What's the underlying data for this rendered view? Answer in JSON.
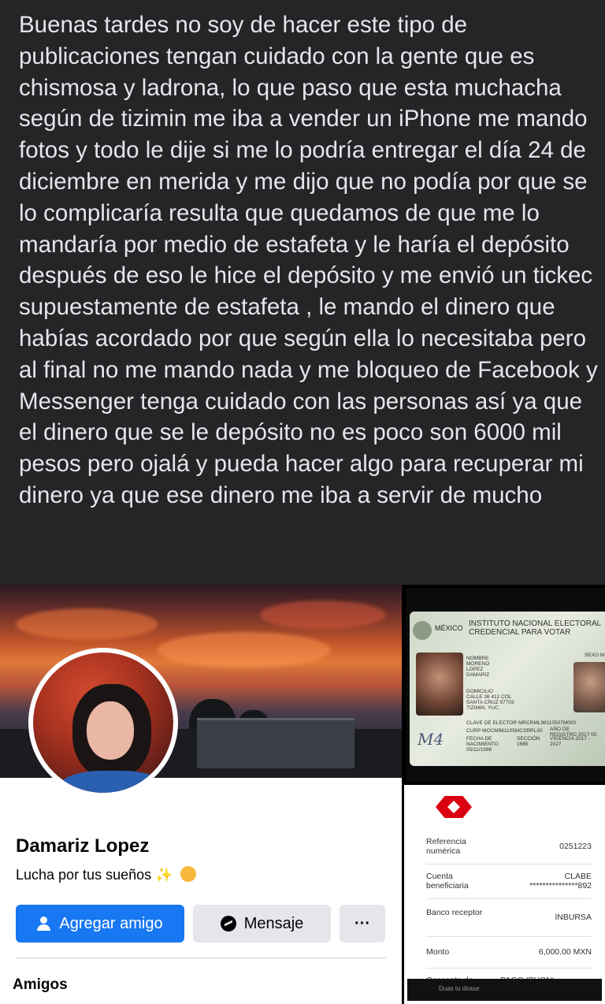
{
  "post": {
    "text": "Buenas tardes no soy de hacer este tipo de publicaciones tengan cuidado con la gente que es chismosa y ladrona, lo que paso que esta muchacha según de tizimin me iba a vender un iPhone me mando fotos y todo le dije si me lo podría entregar el día 24 de diciembre en merida y me dijo que no podía por que se lo complicaría resulta que quedamos de que me lo mandaría por medio de estafeta y le haría el depósito después de eso le hice el depósito y me envió un tickec supuestamente de estafeta ,  le mando el dinero que habías acordado por que según ella lo necesitaba pero al final no me mando nada y me bloqueo de Facebook y Messenger tenga cuidado con las personas así ya que el dinero que se le depósito no es poco son 6000 mil pesos pero ojalá y pueda hacer algo para recuperar mi dinero ya que ese dinero me iba a servir de mucho"
  },
  "profile": {
    "name": "Damariz Lopez",
    "bio": "Lucha por tus sueños",
    "bio_sparkle": "✨",
    "add_friend_label": "Agregar amigo",
    "message_label": "Mensaje",
    "more_label": "···",
    "friends_label": "Amigos"
  },
  "id_card": {
    "country": "MÉXICO",
    "institution": "INSTITUTO NACIONAL ELECTORAL",
    "doc_type": "CREDENCIAL PARA VOTAR",
    "name_label": "NOMBRE",
    "name_lines": "MORENO LOPEZ DAMARIZ",
    "address_label": "DOMICILIO",
    "address": "CALLE 36 412 COL SANTA CRUZ 97703 TIZIMIN, YUC.",
    "elector_key": "CLAVE DE ELECTOR MRCRML98110507M000",
    "curp": "CURP MOCM981105MCSRRL00",
    "registro": "AÑO DE REGISTRO 2017 00",
    "birth": "FECHA DE NACIMIENTO 05/11/1998",
    "section": "SECCIÓN 1685",
    "vigencia": "VIGENCIA 2017 - 2027",
    "sexo": "SEXO M"
  },
  "receipt": {
    "rows": [
      {
        "key": "Referencia numérica",
        "value": "0251223"
      },
      {
        "key": "Cuenta beneficiaria",
        "value": "CLABE\n***************892"
      },
      {
        "key": "Banco receptor",
        "value": "INBURSA"
      },
      {
        "key": "Monto",
        "value": "6,000.00 MXN"
      },
      {
        "key": "Concepto de",
        "value": "PAGO IPHON'"
      }
    ],
    "footer": "Duas tu dirase"
  },
  "colors": {
    "accent": "#1877f2",
    "bank_red": "#db0011",
    "post_bg": "#242526"
  }
}
